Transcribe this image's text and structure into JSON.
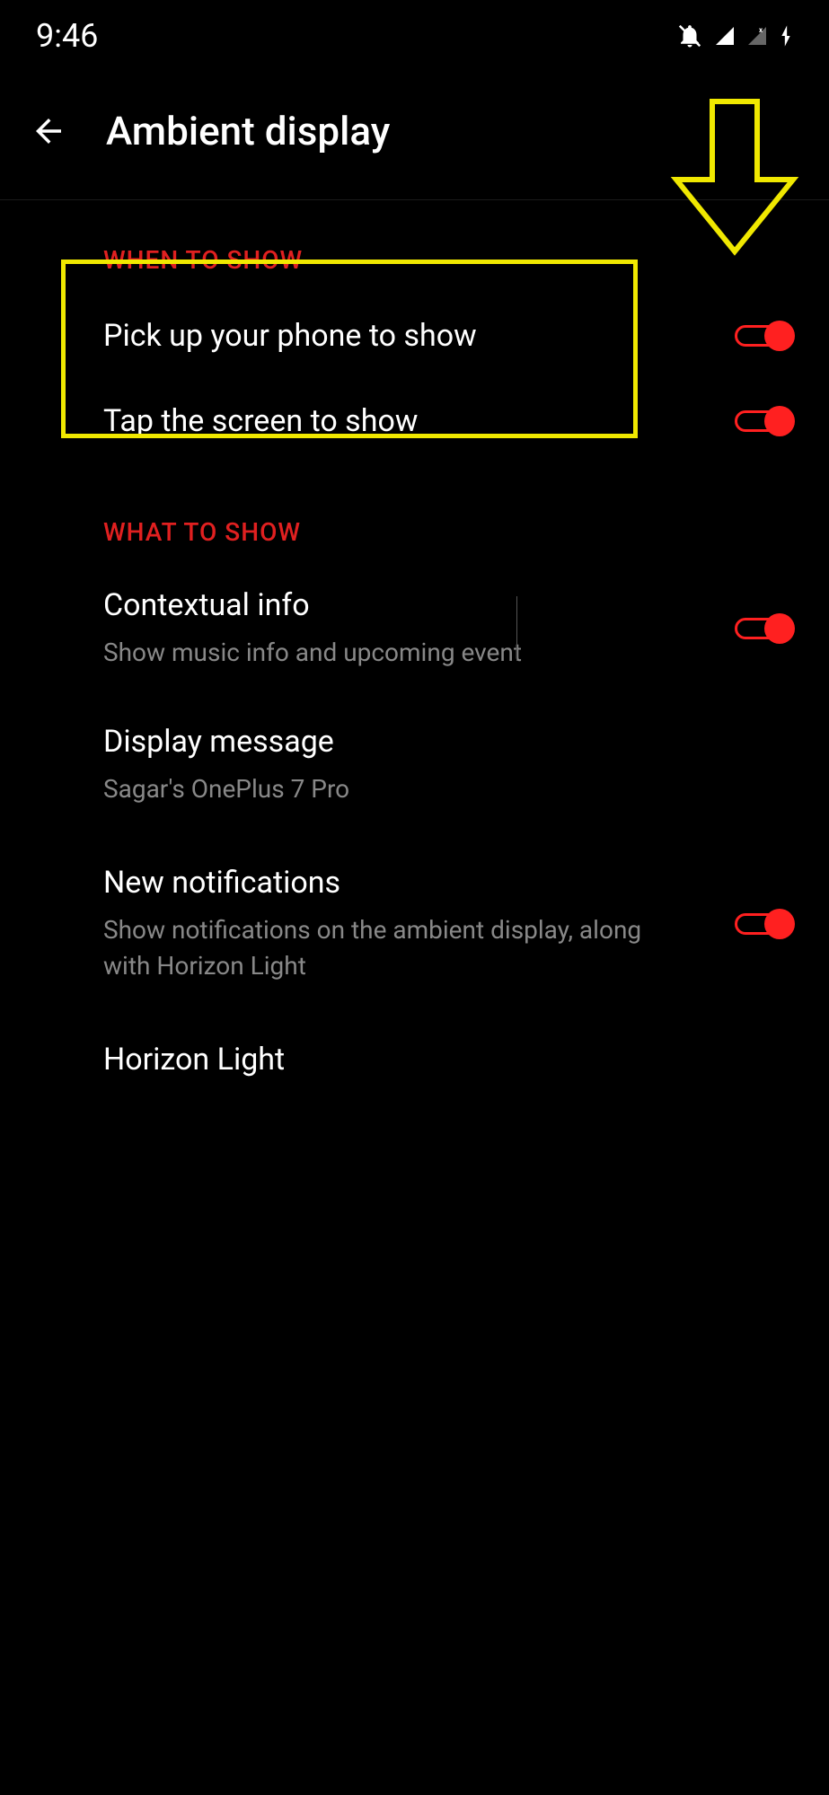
{
  "status_bar": {
    "time": "9:46"
  },
  "app_bar": {
    "title": "Ambient display"
  },
  "sections": {
    "when_to_show": {
      "header": "WHEN TO SHOW",
      "items": [
        {
          "title": "Pick up your phone to show",
          "toggle_on": true
        },
        {
          "title": "Tap the screen to show",
          "toggle_on": true
        }
      ]
    },
    "what_to_show": {
      "header": "WHAT TO SHOW",
      "items": [
        {
          "title": "Contextual info",
          "subtitle": "Show music info and upcoming event",
          "toggle_on": true
        },
        {
          "title": "Display message",
          "subtitle": "Sagar's OnePlus 7 Pro"
        },
        {
          "title": "New notifications",
          "subtitle": "Show notifications on the ambient display, along with Horizon Light",
          "toggle_on": true
        },
        {
          "title": "Horizon Light"
        }
      ]
    }
  },
  "annotations": {
    "arrow_color": "#f0e800",
    "highlight_color": "#f0e800"
  }
}
